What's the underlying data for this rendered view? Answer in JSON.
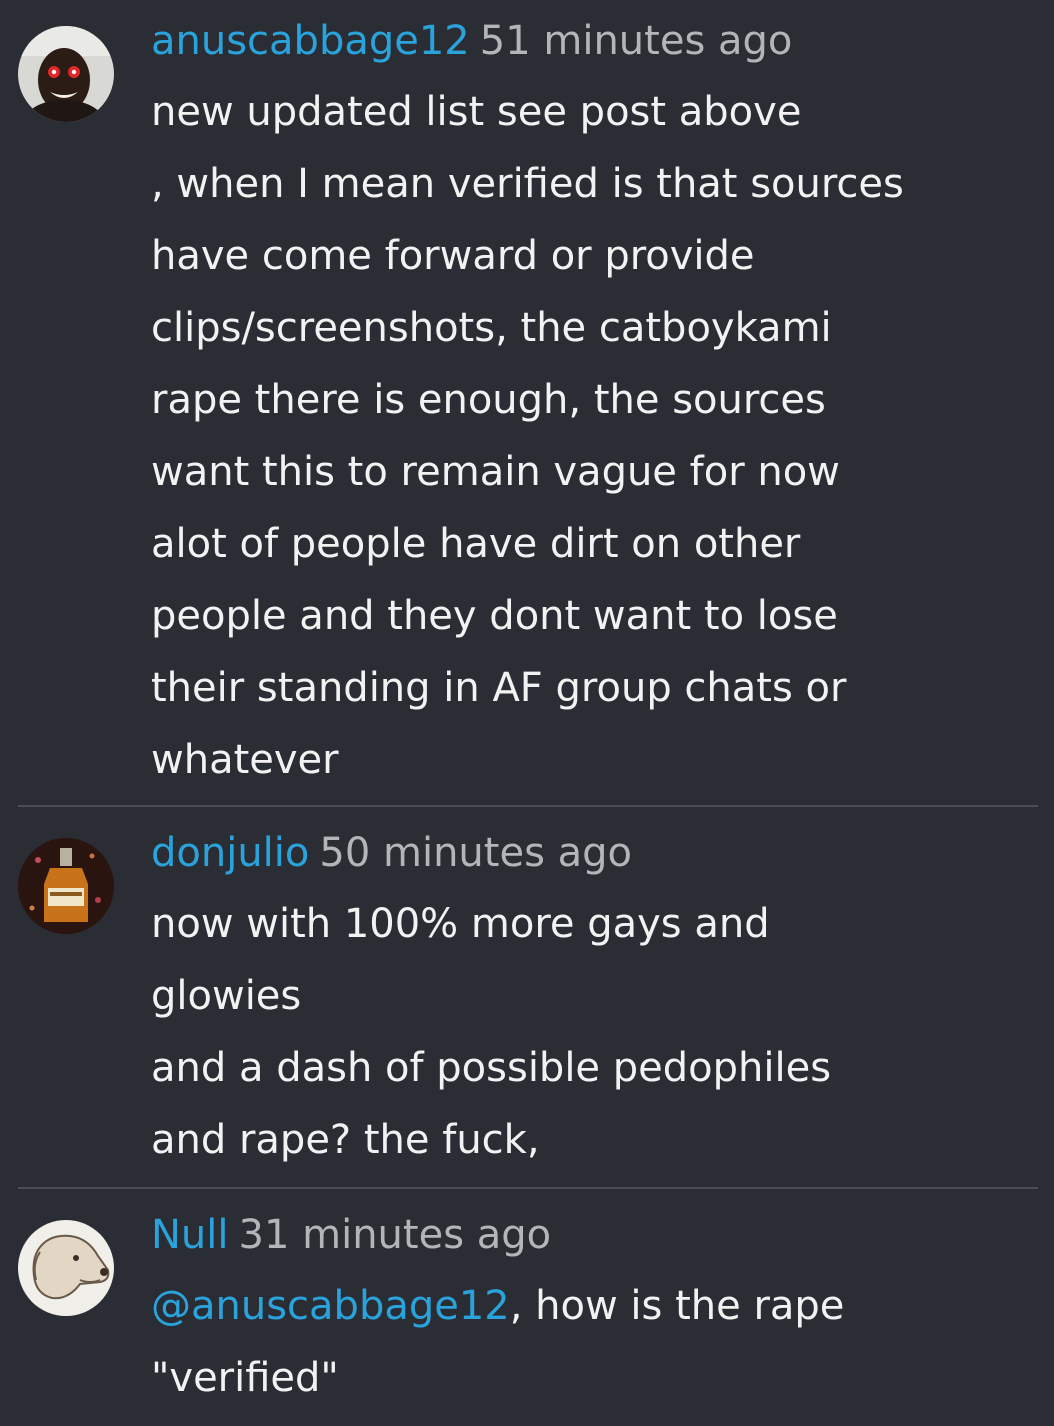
{
  "comments": [
    {
      "author": "anuscabbage12",
      "time": "51 minutes ago",
      "avatar_icon": "user-avatar-photo",
      "lines": [
        "new updated list see post above",
        ", when I mean verified is that sources",
        "have come forward or provide",
        "clips/screenshots, the catboykami",
        "rape there is enough, the sources",
        "want this to remain vague for now",
        "alot of people have dirt on other",
        "people and they dont want to lose",
        "their standing in AF group chats or",
        "whatever"
      ]
    },
    {
      "author": "donjulio",
      "time": "50 minutes ago",
      "avatar_icon": "bottle-avatar",
      "lines": [
        "now with 100% more gays and",
        "glowies",
        "and a dash of possible pedophiles",
        "and rape? the fuck,"
      ]
    },
    {
      "author": "Null",
      "time": "31 minutes ago",
      "avatar_icon": "dog-avatar",
      "mention": "@anuscabbage12",
      "mention_rest": ", how is the rape",
      "lines": [
        "\"verified\""
      ]
    }
  ],
  "colors": {
    "background": "#2a2d33",
    "username": "#2aa3dd",
    "timestamp": "#b3b5b8",
    "text": "#f2f2f2",
    "divider": "#4a4d53"
  }
}
